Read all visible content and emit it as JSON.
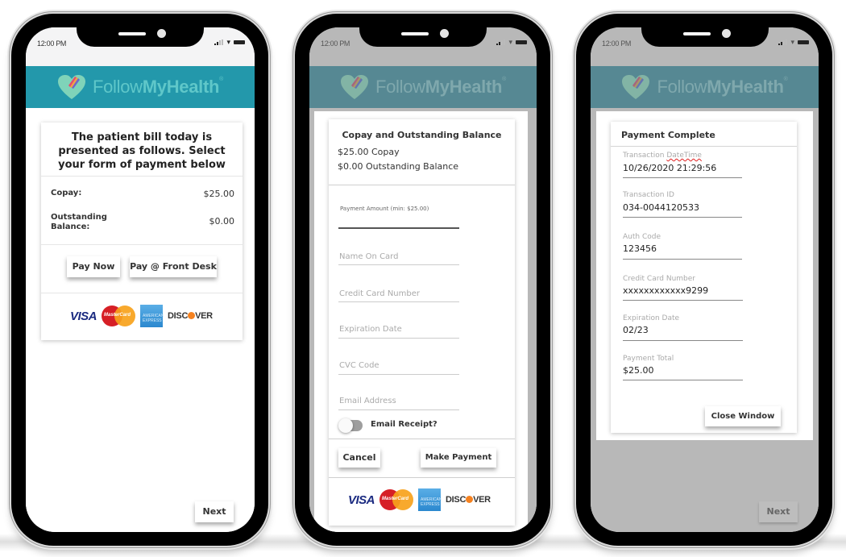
{
  "status_bar": {
    "time": "12:00 PM"
  },
  "app": {
    "brand_light": "Follow",
    "brand_bold": "MyHealth",
    "trademark": "®"
  },
  "screen1": {
    "heading": "The patient bill today is presented as follows. Select your form of payment below",
    "rows": [
      {
        "label": "Copay:",
        "value": "$25.00"
      },
      {
        "label": "Outstanding Balance:",
        "value": "$0.00"
      }
    ],
    "buttons": {
      "pay_now": "Pay Now",
      "pay_front_desk": "Pay @ Front Desk"
    },
    "next": "Next"
  },
  "card_brands": {
    "visa": "VISA",
    "mastercard": "MasterCard",
    "amex": "AMERICAN EXPRESS",
    "discover_a": "DISC",
    "discover_b": "VER"
  },
  "screen2": {
    "title": "Copay and Outstanding Balance",
    "line1": "$25.00 Copay",
    "line2": "$0.00 Outstanding Balance",
    "payment_amount_label": "Payment Amount (min: $25.00)",
    "payment_amount_value": "",
    "fields": {
      "name_on_card": "Name On Card",
      "card_number": "Credit Card Number",
      "expiration": "Expiration Date",
      "cvc": "CVC Code",
      "email": "Email Address"
    },
    "email_receipt": {
      "label": "Email Receipt?",
      "on": false
    },
    "buttons": {
      "cancel": "Cancel",
      "make_payment": "Make Payment"
    }
  },
  "screen3": {
    "title": "Payment Complete",
    "fields": [
      {
        "label_a": "Transaction ",
        "label_b": "DateTime",
        "value": "10/26/2020 21:29:56"
      },
      {
        "label_a": "Transaction ID",
        "label_b": "",
        "value": "034-0044120533"
      },
      {
        "label_a": "Auth Code",
        "label_b": "",
        "value": "123456"
      },
      {
        "label_a": "Credit Card Number",
        "label_b": "",
        "value": "xxxxxxxxxxxx9299"
      },
      {
        "label_a": "Expiration Date",
        "label_b": "",
        "value": "02/23"
      },
      {
        "label_a": "Payment Total",
        "label_b": "",
        "value": "$25.00"
      }
    ],
    "close": "Close Window",
    "next": "Next"
  }
}
